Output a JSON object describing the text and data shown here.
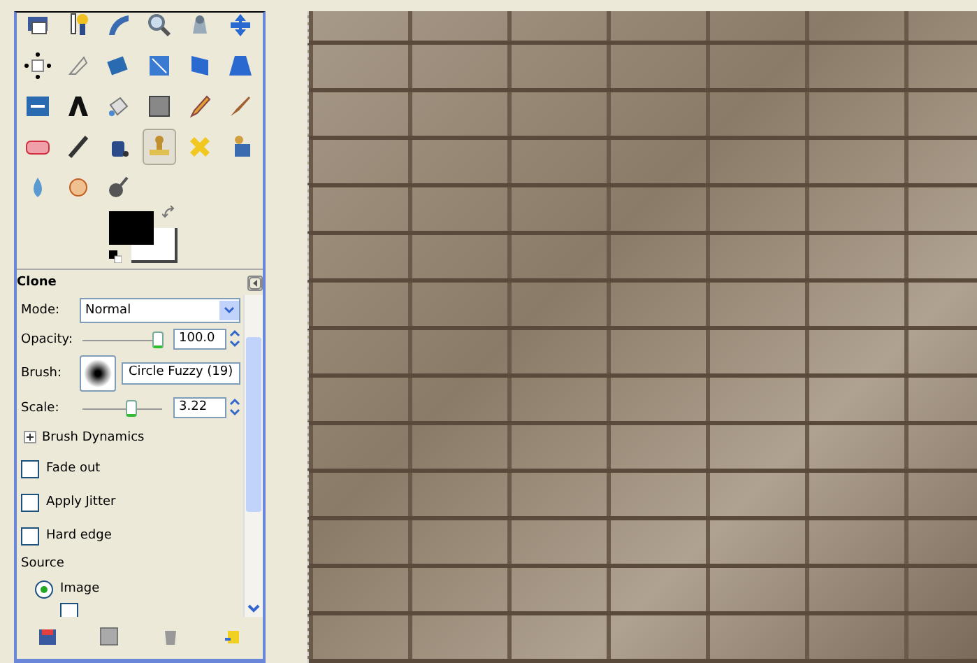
{
  "toolbox": {
    "tools": [
      {
        "selected": false
      },
      {
        "selected": false
      },
      {
        "selected": false
      },
      {
        "selected": false
      },
      {
        "selected": false
      },
      {
        "selected": false
      },
      {
        "selected": false
      },
      {
        "selected": false
      },
      {
        "selected": false
      },
      {
        "selected": false
      },
      {
        "selected": false
      },
      {
        "selected": false
      },
      {
        "selected": false
      },
      {
        "selected": false
      },
      {
        "selected": false
      },
      {
        "selected": false
      },
      {
        "selected": false
      },
      {
        "selected": false
      },
      {
        "selected": false
      },
      {
        "selected": false
      },
      {
        "selected": false
      },
      {
        "selected": true
      },
      {
        "selected": false
      },
      {
        "selected": false
      },
      {
        "selected": false
      },
      {
        "selected": false
      },
      {
        "selected": false
      }
    ]
  },
  "tool_options": {
    "title": "Clone",
    "mode": {
      "label": "Mode:",
      "value": "Normal"
    },
    "opacity": {
      "label": "Opacity:",
      "level": 1.0,
      "value": "100.0"
    },
    "brush": {
      "label": "Brush:",
      "value": "Circle Fuzzy (19)"
    },
    "scale": {
      "label": "Scale:",
      "level": 0.62,
      "value": "3.22"
    },
    "brush_dynamics": {
      "label": "Brush Dynamics",
      "expanded": false
    },
    "checkboxes": [
      {
        "label": "Fade out",
        "checked": false
      },
      {
        "label": "Apply Jitter",
        "checked": false
      },
      {
        "label": "Hard edge",
        "checked": false
      }
    ],
    "source": {
      "label": "Source",
      "options": [
        {
          "label": "Image",
          "selected": true
        }
      ]
    },
    "sample_merged": {
      "checked": false
    }
  }
}
